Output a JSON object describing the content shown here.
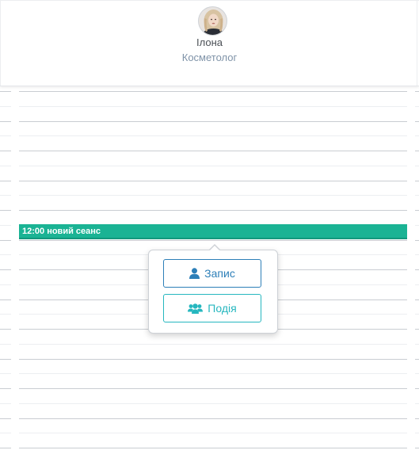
{
  "staff": {
    "name": "Ілона",
    "role": "Косметолог",
    "avatar_icon": "user-photo-avatar"
  },
  "calendar": {
    "event": {
      "label": "12:00 новий сеанс",
      "color": "#1ab394"
    }
  },
  "popover": {
    "record_button": {
      "label": "Запис",
      "icon": "user-icon",
      "color": "#2d7fb8"
    },
    "event_button": {
      "label": "Подія",
      "icon": "users-icon",
      "color": "#26b7bf"
    }
  }
}
